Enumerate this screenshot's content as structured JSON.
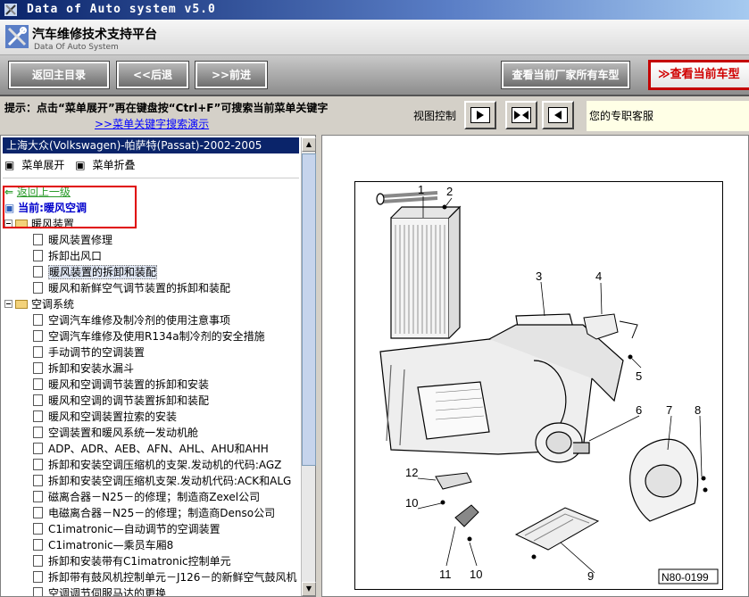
{
  "window": {
    "title": "Data of Auto system v5.0"
  },
  "header": {
    "title": "汽车维修技术支持平台",
    "subtitle": "Data Of Auto System"
  },
  "nav": {
    "home": "返回主目录",
    "back": "<<后退",
    "forward": ">>前进",
    "all_models": "查看当前厂家所有车型",
    "current_model": "查看当前车型"
  },
  "tip": {
    "text": "提示：点击“菜单展开”再在键盘按“Ctrl+F”可搜索当前菜单关键字",
    "link": ">>菜单关键字搜索演示",
    "view_control": "视图控制",
    "service": "您的专职客服"
  },
  "sidebar": {
    "breadcrumb": "上海大众(Volkswagen)-帕萨特(Passat)-2002-2005",
    "expand": "菜单展开",
    "collapse": "菜单折叠",
    "back_link": "返回上一级",
    "current": "当前:暖风空调",
    "heating_folder": "暖风装置",
    "heating_items": [
      "暖风装置修理",
      "拆卸出风口",
      "暖风装置的拆卸和装配",
      "暖风和新鲜空气调节装置的拆卸和装配"
    ],
    "ac_folder": "空调系统",
    "ac_items": [
      "空调汽车维修及制冷剂的使用注意事项",
      "空调汽车维修及使用R134a制冷剂的安全措施",
      "手动调节的空调装置",
      "拆卸和安装水漏斗",
      "暖风和空调调节装置的拆卸和安装",
      "暖风和空调的调节装置拆卸和装配",
      "暖风和空调装置拉索的安装",
      "空调装置和暖风系统一发动机舱",
      "ADP、ADR、AEB、AFN、AHL、AHU和AHH",
      "拆卸和安装空调压缩机的支架.发动机的代码:AGZ",
      "拆卸和安装空调压缩机支架.发动机代码:ACK和ALG",
      "磁离合器－N25－的修理；制造商Zexel公司",
      "电磁离合器－N25－的修理；制造商Denso公司",
      "C1imatronic—自动调节的空调装置",
      "C1imatronic—乘员车厢8",
      "拆卸和安装带有C1imatronic控制单元",
      "拆卸带有鼓风机控制单元－J126－的新鲜空气鼓风机",
      "空调调节伺服马达的更换"
    ]
  },
  "diagram": {
    "labels": [
      "1",
      "2",
      "3",
      "4",
      "5",
      "6",
      "7",
      "8",
      "12",
      "10",
      "11",
      "10",
      "9"
    ],
    "code": "N80-0199"
  },
  "colors": {
    "title_bar": "#0a246a",
    "red_accent": "#c40000",
    "link": "#0000ff"
  },
  "chart_data": {
    "type": "diagram",
    "title": "",
    "parts": [
      "1",
      "2",
      "3",
      "4",
      "5",
      "6",
      "7",
      "8",
      "9",
      "10",
      "11",
      "12"
    ],
    "figure_code": "N80-0199"
  }
}
